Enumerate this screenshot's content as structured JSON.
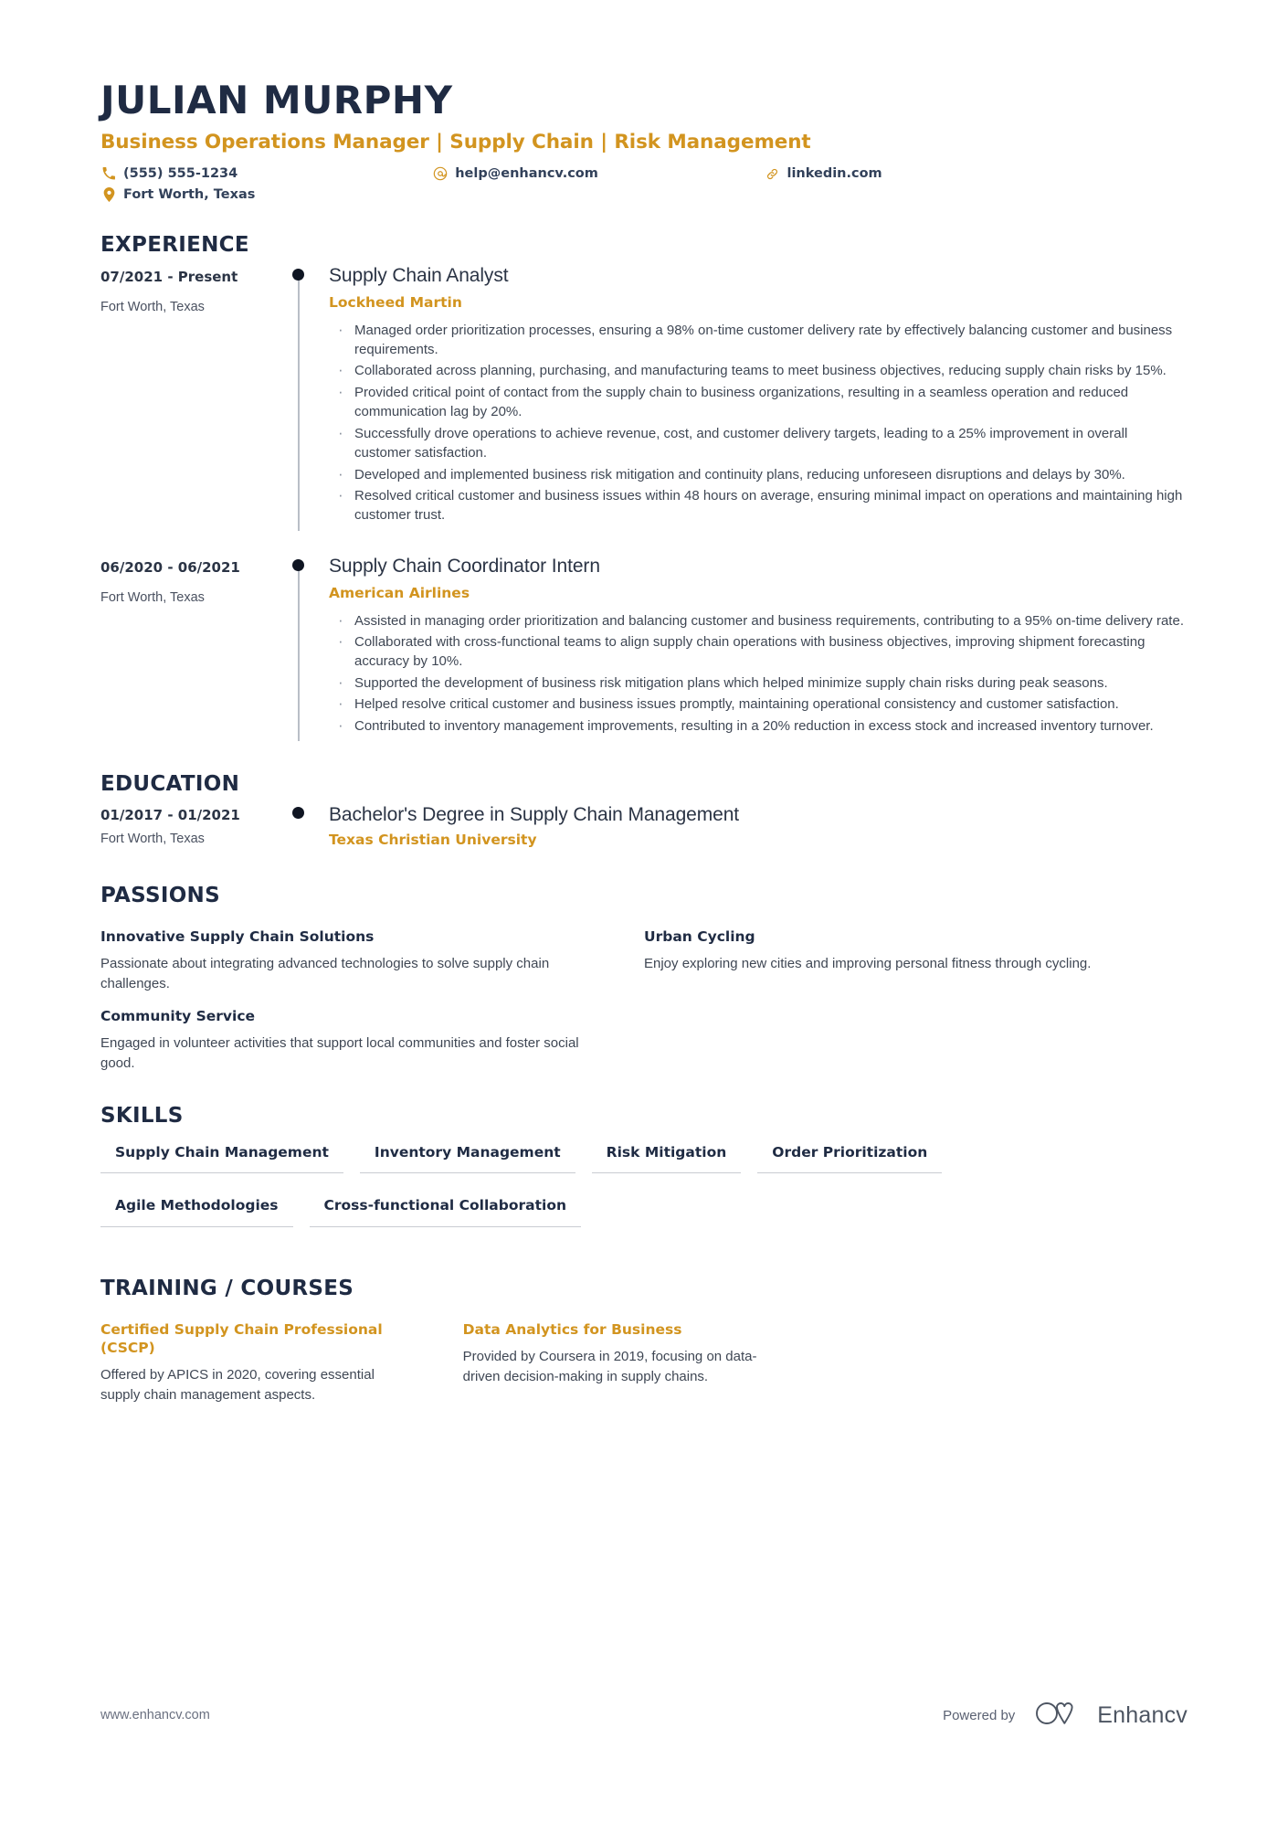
{
  "header": {
    "full_name": "JULIAN MURPHY",
    "headline": "Business Operations Manager | Supply Chain | Risk Management",
    "contacts": {
      "phone": "(555) 555-1234",
      "email": "help@enhancv.com",
      "linkedin": "linkedin.com",
      "location": "Fort Worth, Texas"
    }
  },
  "experience": {
    "section_title": "EXPERIENCE",
    "entries": [
      {
        "date": "07/2021 - Present",
        "location": "Fort Worth, Texas",
        "title": "Supply Chain Analyst",
        "organization": "Lockheed Martin",
        "bullets": [
          "Managed order prioritization processes, ensuring a 98% on-time customer delivery rate by effectively balancing customer and business requirements.",
          "Collaborated across planning, purchasing, and manufacturing teams to meet business objectives, reducing supply chain risks by 15%.",
          "Provided critical point of contact from the supply chain to business organizations, resulting in a seamless operation and reduced communication lag by 20%.",
          "Successfully drove operations to achieve revenue, cost, and customer delivery targets, leading to a 25% improvement in overall customer satisfaction.",
          "Developed and implemented business risk mitigation and continuity plans, reducing unforeseen disruptions and delays by 30%.",
          "Resolved critical customer and business issues within 48 hours on average, ensuring minimal impact on operations and maintaining high customer trust."
        ]
      },
      {
        "date": "06/2020 - 06/2021",
        "location": "Fort Worth, Texas",
        "title": "Supply Chain Coordinator Intern",
        "organization": "American Airlines",
        "bullets": [
          "Assisted in managing order prioritization and balancing customer and business requirements, contributing to a 95% on-time delivery rate.",
          "Collaborated with cross-functional teams to align supply chain operations with business objectives, improving shipment forecasting accuracy by 10%.",
          "Supported the development of business risk mitigation plans which helped minimize supply chain risks during peak seasons.",
          "Helped resolve critical customer and business issues promptly, maintaining operational consistency and customer satisfaction.",
          "Contributed to inventory management improvements, resulting in a 20% reduction in excess stock and increased inventory turnover."
        ]
      }
    ]
  },
  "education": {
    "section_title": "EDUCATION",
    "entries": [
      {
        "date": "01/2017 - 01/2021",
        "location": "Fort Worth, Texas",
        "title": "Bachelor's Degree in Supply Chain Management",
        "organization": "Texas Christian University"
      }
    ]
  },
  "passions": {
    "section_title": "PASSIONS",
    "items": [
      {
        "title": "Innovative Supply Chain Solutions",
        "text": "Passionate about integrating advanced technologies to solve supply chain challenges."
      },
      {
        "title": "Urban Cycling",
        "text": "Enjoy exploring new cities and improving personal fitness through cycling."
      },
      {
        "title": "Community Service",
        "text": "Engaged in volunteer activities that support local communities and foster social good."
      }
    ]
  },
  "skills": {
    "section_title": "SKILLS",
    "items": [
      "Supply Chain Management",
      "Inventory Management",
      "Risk Mitigation",
      "Order Prioritization",
      "Agile Methodologies",
      "Cross-functional Collaboration"
    ]
  },
  "training": {
    "section_title": "TRAINING / COURSES",
    "items": [
      {
        "title": "Certified Supply Chain Professional (CSCP)",
        "text": "Offered by APICS in 2020, covering essential supply chain management aspects."
      },
      {
        "title": "Data Analytics for Business",
        "text": "Provided by Coursera in 2019, focusing on data-driven decision-making in supply chains."
      }
    ]
  },
  "footer": {
    "url": "www.enhancv.com",
    "powered_by": "Powered by",
    "brand": "Enhancv"
  },
  "colors": {
    "accent": "#d2941f",
    "heading": "#1f2b43",
    "body": "#3f4754",
    "rail": "#b9bec7"
  }
}
